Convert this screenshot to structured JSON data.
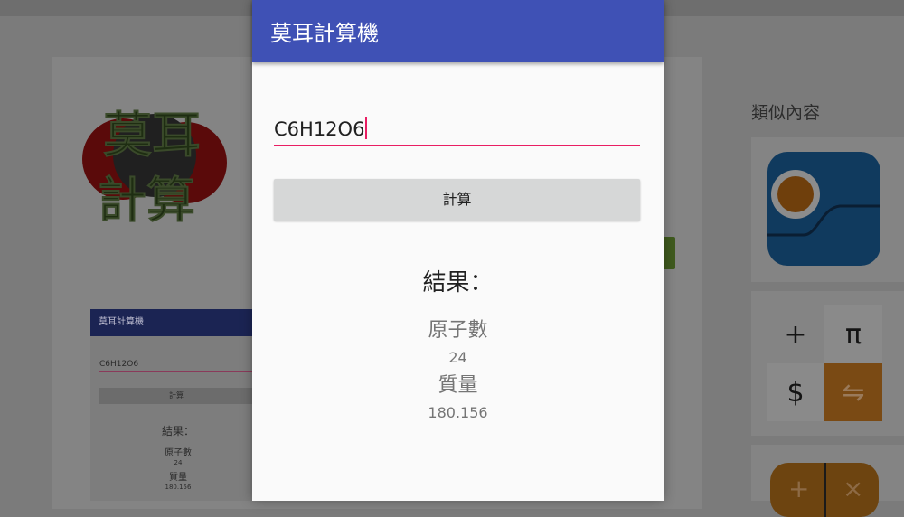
{
  "background": {
    "logo_text": [
      "莫耳",
      "計算"
    ],
    "screenshot": {
      "app_title": "莫耳計算機",
      "input_value": "C6H12O6",
      "button_label": "計算",
      "result_title": "結果：",
      "atoms_label": "原子數",
      "atoms_value": "24",
      "mass_label": "質量",
      "mass_value": "180.156"
    },
    "similar_title": "類似內容",
    "calc_keys": [
      "+",
      "π",
      "$",
      "⇋"
    ]
  },
  "dialog": {
    "app_title": "莫耳計算機",
    "formula_input": "C6H12O6",
    "calculate_button": "計算",
    "result_title": "結果：",
    "atoms_label": "原子數",
    "atoms_value": "24",
    "mass_label": "質量",
    "mass_value": "180.156"
  },
  "colors": {
    "app_bar": "#3f51b5",
    "accent": "#e91e63",
    "button": "#d6d7d7"
  }
}
